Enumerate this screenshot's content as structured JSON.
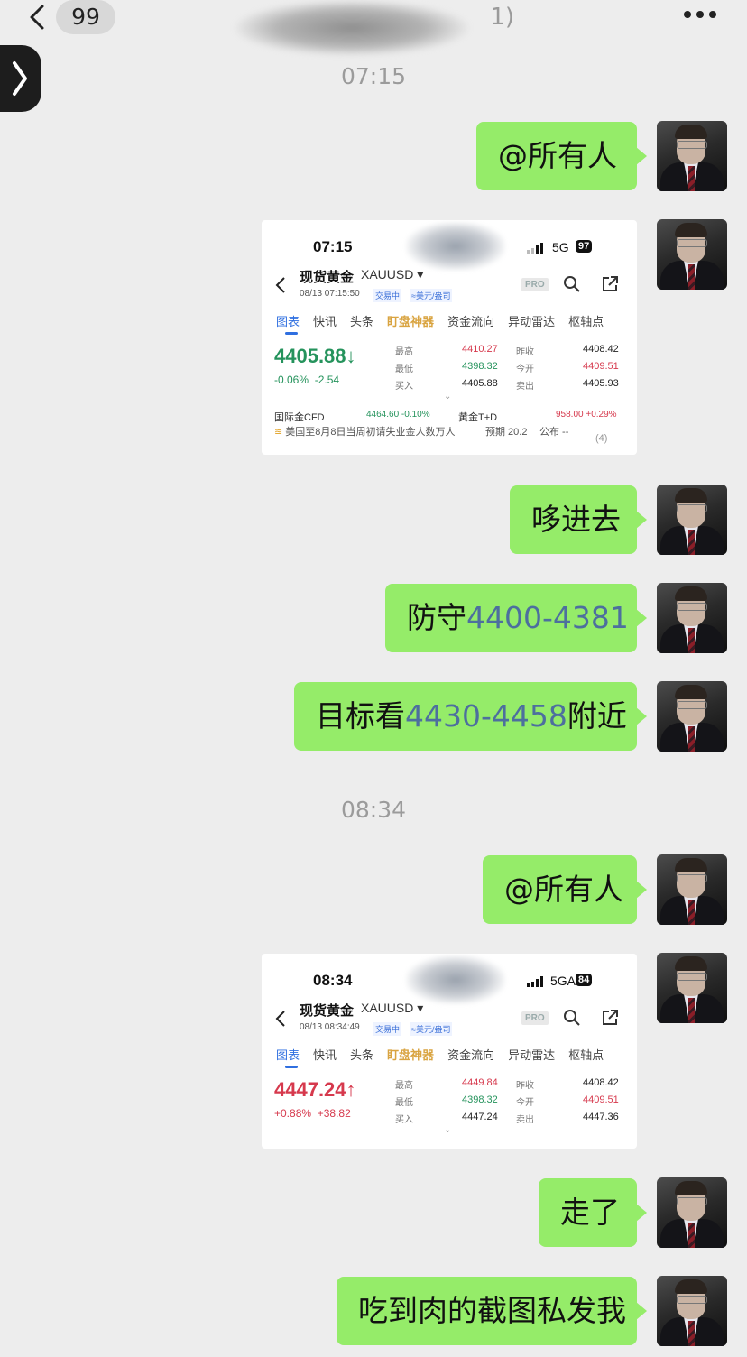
{
  "header": {
    "unread_count": "99",
    "chat_title_suffix": "1)"
  },
  "timestamps": [
    "07:15",
    "08:34"
  ],
  "messages": {
    "m1": "@所有人",
    "m3": "哆进去",
    "m4_prefix": "防守",
    "m4_num": "4400-4381",
    "m5_prefix": "目标看",
    "m5_num": "4430-4458",
    "m5_suffix": "附近",
    "m6": "@所有人",
    "m8": "走了",
    "m9": "吃到肉的截图私发我"
  },
  "shot1": {
    "status_time": "07:15",
    "network": "5G",
    "battery": "97",
    "instrument": "现货黄金",
    "symbol": "XAUUSD ▾",
    "datetime": "08/13 07:15:50",
    "trading_state": "交易中",
    "currency": "≈美元/盎司",
    "pro": "PRO",
    "tabs": [
      "图表",
      "快讯",
      "头条",
      "盯盘神器",
      "资金流向",
      "异动雷达",
      "枢轴点"
    ],
    "price": "4405.88",
    "change_pct": "-0.06%",
    "change_abs": "-2.54",
    "stats": {
      "high_label": "最高",
      "high": "4410.27",
      "low_label": "最低",
      "low": "4398.32",
      "bid_label": "买入",
      "bid": "4405.88",
      "prev_label": "昨收",
      "prev": "4408.42",
      "open_label": "今开",
      "open": "4409.51",
      "ask_label": "卖出",
      "ask": "4405.93"
    },
    "bottom": {
      "cfd_label": "国际金CFD",
      "cfd_value": "4464.60 -0.10%",
      "td_label": "黄金T+D",
      "td_value": "958.00 +0.29%"
    },
    "news": "美国至8月8日当周初请失业金人数万人",
    "news_forecast": "预期 20.2",
    "news_publish": "公布 --",
    "news_count": "(4)"
  },
  "shot2": {
    "status_time": "08:34",
    "network": "5GA",
    "battery": "84",
    "instrument": "现货黄金",
    "symbol": "XAUUSD ▾",
    "datetime": "08/13 08:34:49",
    "trading_state": "交易中",
    "currency": "≈美元/盎司",
    "pro": "PRO",
    "tabs": [
      "图表",
      "快讯",
      "头条",
      "盯盘神器",
      "资金流向",
      "异动雷达",
      "枢轴点"
    ],
    "price": "4447.24",
    "change_pct": "+0.88%",
    "change_abs": "+38.82",
    "stats": {
      "high_label": "最高",
      "high": "4449.84",
      "low_label": "最低",
      "low": "4398.32",
      "bid_label": "买入",
      "bid": "4447.24",
      "prev_label": "昨收",
      "prev": "4408.42",
      "open_label": "今开",
      "open": "4409.51",
      "ask_label": "卖出",
      "ask": "4447.36"
    }
  },
  "colors": {
    "bubble": "#95ec69",
    "background": "#ededed",
    "number_highlight": "#4d6f9e",
    "price_down": "#25935c",
    "price_up": "#d6394d"
  }
}
